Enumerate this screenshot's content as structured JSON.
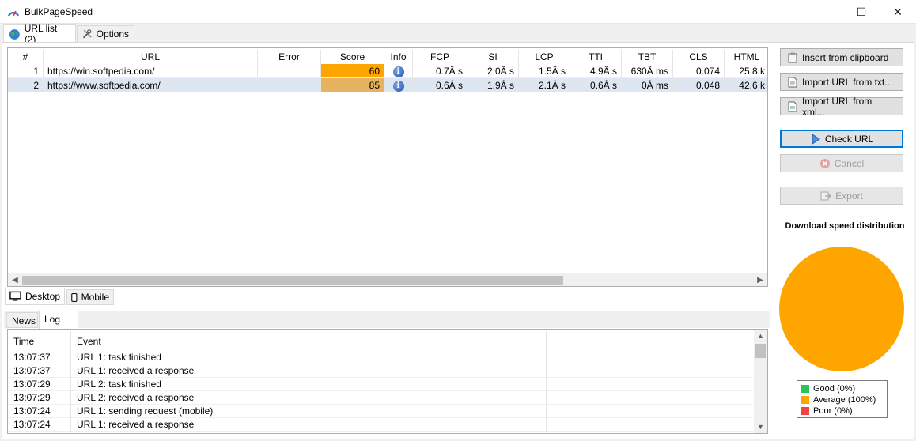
{
  "window": {
    "title": "BulkPageSpeed",
    "min": "—",
    "max": "☐",
    "close": "✕"
  },
  "top_tabs": [
    {
      "label": "URL list (2)",
      "icon": "globe-icon"
    },
    {
      "label": "Options",
      "icon": "tools-icon"
    }
  ],
  "grid": {
    "columns": [
      "#",
      "URL",
      "Error",
      "Score",
      "Info",
      "FCP",
      "SI",
      "LCP",
      "TTI",
      "TBT",
      "CLS",
      "HTML"
    ],
    "rows": [
      {
        "num": "1",
        "url": "https://win.softpedia.com/",
        "error": "",
        "score": "60",
        "fcp": "0.7Â s",
        "si": "2.0Â s",
        "lcp": "1.5Â s",
        "tti": "4.9Â s",
        "tbt": "630Â ms",
        "cls": "0.074",
        "html": "25.8 k",
        "score_color": "#ffa500"
      },
      {
        "num": "2",
        "url": "https://www.softpedia.com/",
        "error": "",
        "score": "85",
        "fcp": "0.6Â s",
        "si": "1.9Â s",
        "lcp": "2.1Â s",
        "tti": "0.6Â s",
        "tbt": "0Â ms",
        "cls": "0.048",
        "html": "42.6 k",
        "score_color": "#e6b461"
      }
    ]
  },
  "view_tabs": {
    "desktop": "Desktop",
    "mobile": "Mobile"
  },
  "bottom_tabs": {
    "news": "News",
    "log": "Log"
  },
  "log": {
    "columns": [
      "Time",
      "Event"
    ],
    "rows": [
      {
        "time": "13:07:37",
        "event": "URL 1: task finished"
      },
      {
        "time": "13:07:37",
        "event": "URL 1: received a response"
      },
      {
        "time": "13:07:29",
        "event": "URL 2: task finished"
      },
      {
        "time": "13:07:29",
        "event": "URL 2: received a response"
      },
      {
        "time": "13:07:24",
        "event": "URL 1: sending request (mobile)"
      },
      {
        "time": "13:07:24",
        "event": "URL 1: received a response"
      }
    ]
  },
  "buttons": {
    "insert": "Insert from clipboard",
    "import_txt": "Import URL from txt...",
    "import_xml": "Import URL from xml...",
    "check": "Check URL",
    "cancel": "Cancel",
    "export": "Export"
  },
  "chart_data": {
    "type": "pie",
    "title": "Download speed distribution",
    "categories": [
      "Good (0%)",
      "Average (100%)",
      "Poor (0%)"
    ],
    "values": [
      0,
      100,
      0
    ],
    "colors": [
      "#22c55e",
      "#ffa500",
      "#ef4444"
    ],
    "legend_position": "bottom"
  },
  "colors": {
    "accent": "#0078d7",
    "average": "#ffa500"
  }
}
